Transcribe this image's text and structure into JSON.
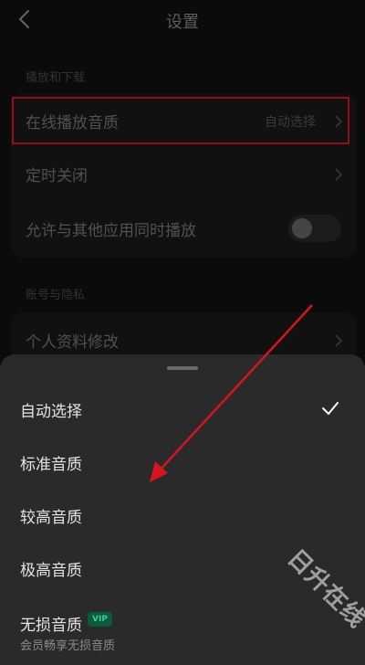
{
  "header": {
    "title": "设置"
  },
  "sections": {
    "playback": {
      "label": "播放和下载",
      "quality_label": "在线播放音质",
      "quality_value": "自动选择",
      "timer_label": "定时关闭",
      "allow_label": "允许与其他应用同时播放"
    },
    "account": {
      "label": "账号与隐私",
      "profile_label": "个人资料修改"
    }
  },
  "sheet": {
    "options": [
      "自动选择",
      "标准音质",
      "较高音质",
      "极高音质",
      "无损音质"
    ],
    "selected": "自动选择",
    "vip_badge": "VIP",
    "lossless_sub": "会员畅享无损音质"
  },
  "watermark": "日升在线",
  "colors": {
    "highlight": "#e0182b",
    "arrow": "#d8141e",
    "vip_text": "#37d48b"
  },
  "icons": {
    "back": "chevron-left-icon",
    "chevron": "chevron-right-icon",
    "check": "check-icon"
  }
}
